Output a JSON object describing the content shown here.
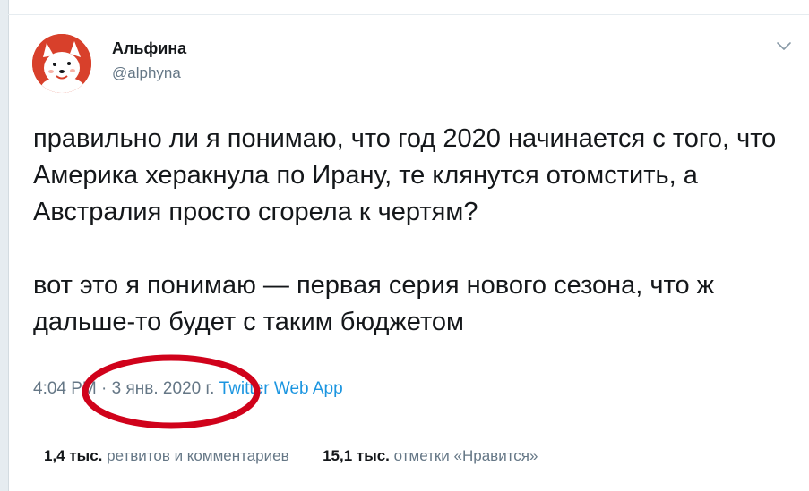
{
  "author": {
    "name": "Альфина",
    "handle": "@alphyna",
    "avatar_icon": "white-fox-avatar-icon",
    "avatar_bg": "#d8402b"
  },
  "menu_icon": "chevron-down-icon",
  "tweet": {
    "paragraphs": [
      "правильно ли я понимаю, что год 2020 начинается с того, что Америка херакнула по Ирану, те клянутся отомстить, а Австралия просто сгорела к чертям?",
      "вот это я понимаю — первая серия нового сезона, что ж дальше-то будет с таким бюджетом"
    ]
  },
  "meta": {
    "time": "4:04 PM",
    "separator": " · ",
    "date": "3 янв. 2020 г.",
    "source": "Twitter Web App"
  },
  "annotation": {
    "shape": "ellipse",
    "color": "#d0021b"
  },
  "stats": {
    "retweets_count": "1,4 тыс.",
    "retweets_label": "ретвитов и комментариев",
    "likes_count": "15,1 тыс.",
    "likes_label": "отметки «Нравится»"
  },
  "colors": {
    "text": "#14171a",
    "secondary": "#657786",
    "link": "#1b95e0",
    "border": "#e6ecf0"
  }
}
